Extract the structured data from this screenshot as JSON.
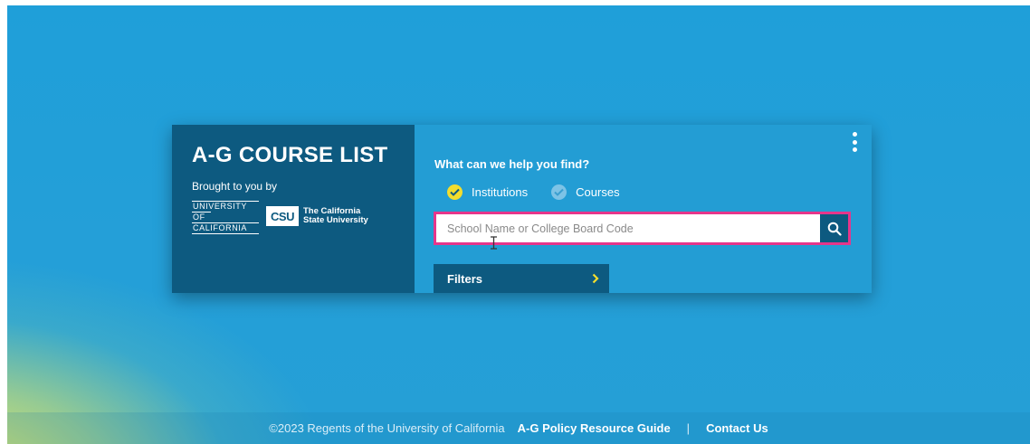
{
  "card": {
    "brand_title": "A-G COURSE LIST",
    "brought_by": "Brought to you by",
    "uc_logo": [
      "UNIVERSITY",
      "OF",
      "CALIFORNIA"
    ],
    "csu_logo": {
      "mark": "CSU",
      "line1": "The California",
      "line2": "State University"
    },
    "prompt": "What can we help you find?",
    "options": [
      {
        "label": "Institutions",
        "selected": true
      },
      {
        "label": "Courses",
        "selected": false
      }
    ],
    "search": {
      "placeholder": "School Name or College Board Code",
      "value": ""
    },
    "filters_label": "Filters",
    "icons": {
      "more": "vertical-dots-icon",
      "search": "magnifier-icon",
      "filters": "chevron-right-icon"
    }
  },
  "footer": {
    "copyright": "©2023 Regents of the University of California",
    "link_policy": "A-G Policy Resource Guide",
    "separator": "|",
    "link_contact": "Contact Us"
  },
  "colors": {
    "panel_dark": "#0d5a80",
    "panel_light": "#239dd4",
    "background": "#1f9fd9",
    "check_selected": "#f2dd2e",
    "search_border": "#e6368b"
  }
}
